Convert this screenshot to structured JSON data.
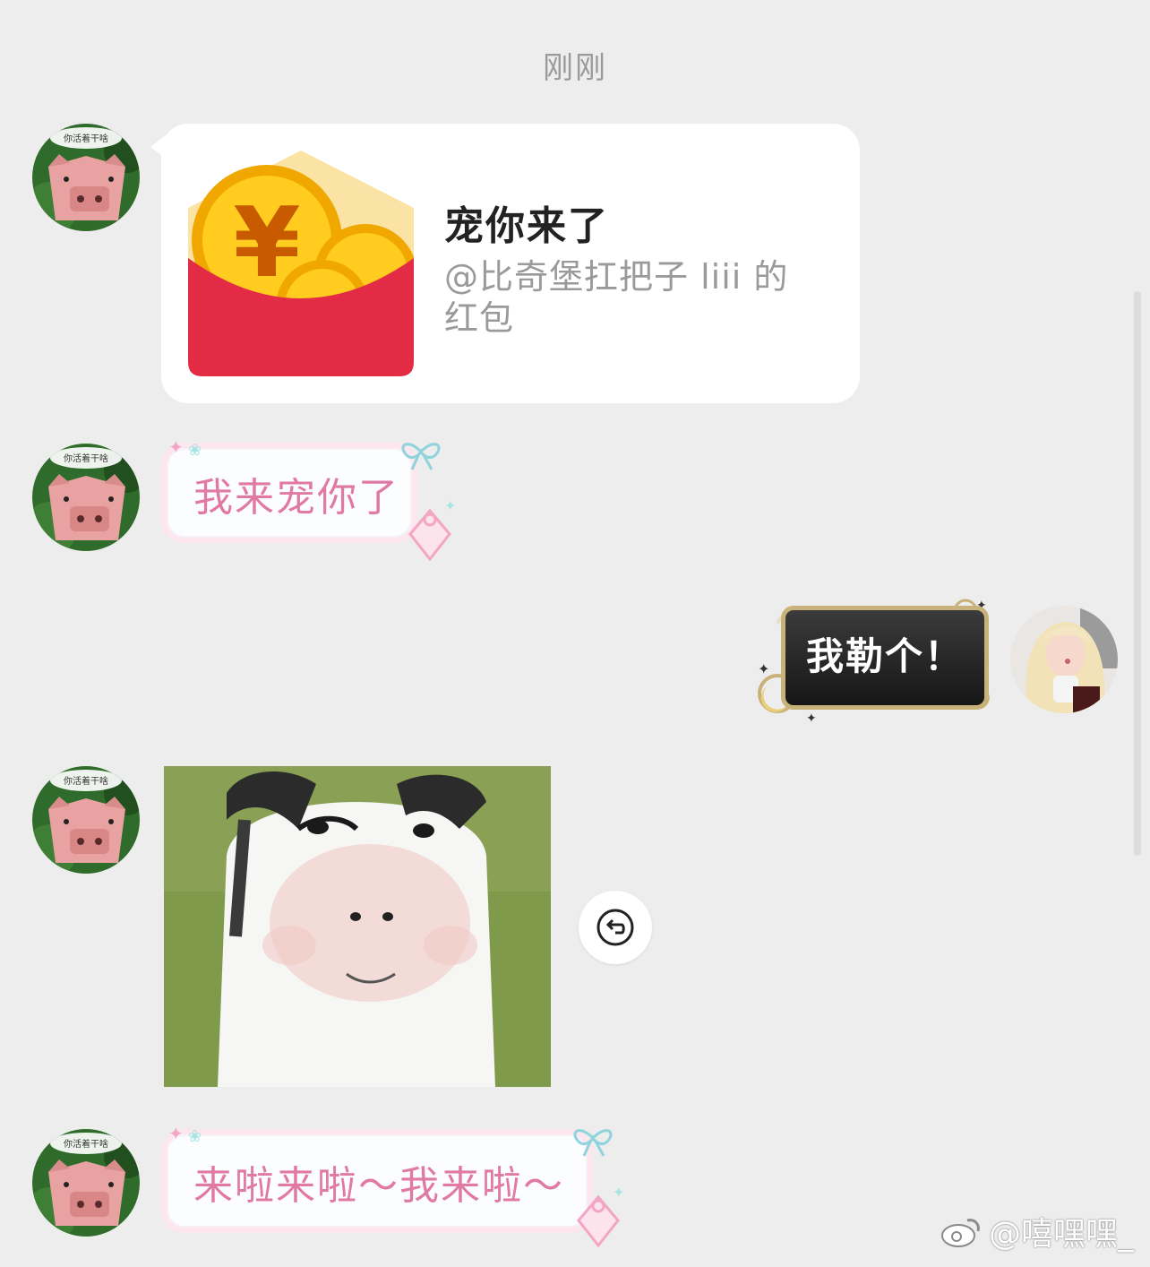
{
  "timestamp": "刚刚",
  "messages": [
    {
      "type": "red_packet",
      "sender": "left",
      "avatar_text": "你活着干啥",
      "title": "宠你来了",
      "subtitle": "@比奇堡扛把子 liii 的红包"
    },
    {
      "type": "text",
      "sender": "left",
      "avatar_text": "你活着干啥",
      "text": "我来宠你了"
    },
    {
      "type": "text",
      "sender": "right",
      "text": "我勒个！"
    },
    {
      "type": "image",
      "sender": "left",
      "avatar_text": "你活着干啥",
      "image": "cow-face-sticker"
    },
    {
      "type": "text",
      "sender": "left",
      "avatar_text": "你活着干啥",
      "text": "来啦来啦～我来啦～"
    }
  ],
  "watermark": "@嘻嘿嘿_",
  "colors": {
    "background": "#ededed",
    "pink_text": "#e07aa4",
    "red_packet": "#e42b45",
    "coin": "#f4b400"
  }
}
